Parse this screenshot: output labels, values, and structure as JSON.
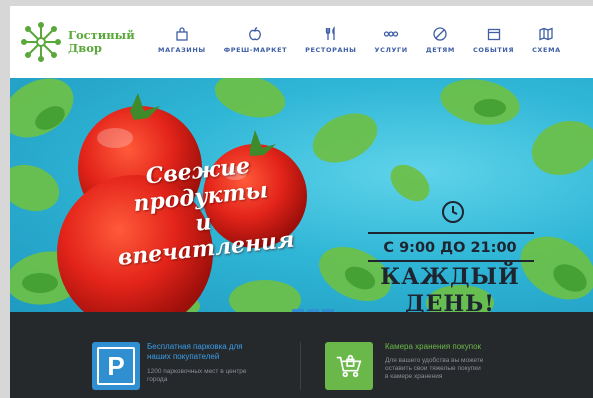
{
  "logo": {
    "line1": "Гостиный",
    "line2": "Двор"
  },
  "nav": [
    {
      "label": "МАГАЗИНЫ",
      "icon": "shopping-bag-icon"
    },
    {
      "label": "ФРЕШ-МАРКЕТ",
      "icon": "apple-icon"
    },
    {
      "label": "РЕСТОРАНЫ",
      "icon": "fork-knife-icon"
    },
    {
      "label": "УСЛУГИ",
      "icon": "services-icon"
    },
    {
      "label": "ДЕТЯМ",
      "icon": "kids-icon"
    },
    {
      "label": "СОБЫТИЯ",
      "icon": "calendar-icon"
    },
    {
      "label": "СХЕМА",
      "icon": "map-icon"
    }
  ],
  "banner": {
    "slogan_line1": "Свежие",
    "slogan_line2": "продукты",
    "slogan_line3": "и впечатления",
    "hours": "С 9:00 ДО 21:00",
    "every_day_line1": "КАЖДЫЙ",
    "every_day_line2": "ДЕНЬ!",
    "slides": 3
  },
  "info": {
    "parking": {
      "title_line1": "Бесплатная парковка для",
      "title_line2": "наших покупателей",
      "desc_line1": "1200 парковочных мест в центре",
      "desc_line2": "города",
      "icon_letter": "P"
    },
    "storage": {
      "title": "Камера хранения покупок",
      "desc_line1": "Для вашего удобства вы можете",
      "desc_line2": "оставить свои тяжелые покупки",
      "desc_line3": "в камере хранения"
    }
  },
  "colors": {
    "brand_green": "#5aa83a",
    "nav_blue": "#3f5fa5",
    "parking_blue": "#2f8fd0",
    "storage_green": "#6ab84a",
    "strip_dark": "#26292c"
  }
}
